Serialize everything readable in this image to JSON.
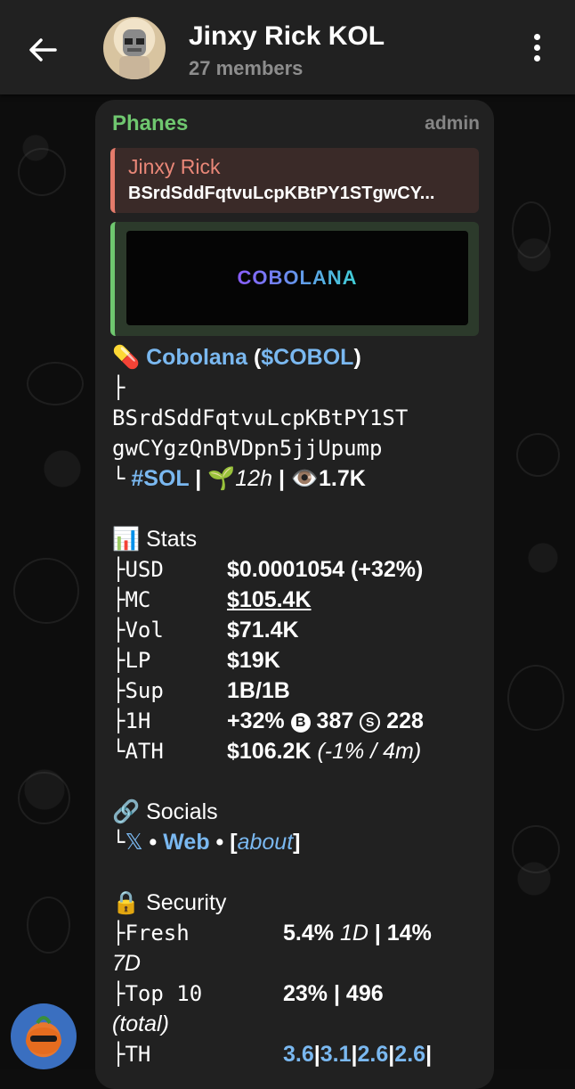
{
  "header": {
    "title": "Jinxy Rick KOL",
    "subtitle": "27 members"
  },
  "message": {
    "sender": "Phanes",
    "role": "admin",
    "reply": {
      "name": "Jinxy Rick",
      "text": "BSrdSddFqtvuLcpKBtPY1STgwCY..."
    },
    "preview_logo": "COBOLANA",
    "token": {
      "emoji": "💊",
      "name": "Cobolana",
      "open_paren": " (",
      "ticker": "$COBOL",
      "close_paren": ")",
      "branch": "├",
      "address_line1": "BSrdSddFqtvuLcpKBtPY1ST",
      "address_line2": "gwCYgzQnBVDpn5jjUpump",
      "end_branch": "└",
      "chain_tag": "#SOL",
      "sep": " | ",
      "age_emoji": "🌱",
      "age": "12h",
      "views_emoji": "👁️",
      "views": "1.7K"
    },
    "stats": {
      "emoji": "📊",
      "heading": "Stats",
      "rows": [
        {
          "key": "├USD",
          "value": "$0.0001054 (+32%)"
        },
        {
          "key": "├MC",
          "value": "$105.4K"
        },
        {
          "key": "├Vol",
          "value": "$71.4K"
        },
        {
          "key": "├LP",
          "value": "$19K"
        },
        {
          "key": "├Sup",
          "value": "1B/1B"
        },
        {
          "key": "├1H",
          "value": "+32%"
        },
        {
          "key": "└ATH",
          "value": "$106.2K"
        }
      ],
      "buys_icon": "B",
      "buys": "387",
      "sells_icon": "S",
      "sells": "228",
      "ath_note": " (-1% / 4m)"
    },
    "socials": {
      "emoji": "🔗",
      "heading": "Socials",
      "branch": "└",
      "x_icon": "𝕏",
      "dot": " • ",
      "web": "Web",
      "about_open": "[",
      "about": "about",
      "about_close": "]"
    },
    "security": {
      "emoji": "🔒",
      "heading": "Security",
      "fresh_key": "├Fresh",
      "fresh_val": "5.4% ",
      "fresh_1d": "1D",
      "fresh_sep": " | 14%",
      "fresh_7d": "7D",
      "top10_key": "├Top 10",
      "top10_val": "23% | 496",
      "top10_total": "(total)",
      "th_key": "├TH",
      "th_vals": [
        "3.6",
        "3.1",
        "2.6",
        "2.6"
      ],
      "th_sep": "|"
    }
  }
}
